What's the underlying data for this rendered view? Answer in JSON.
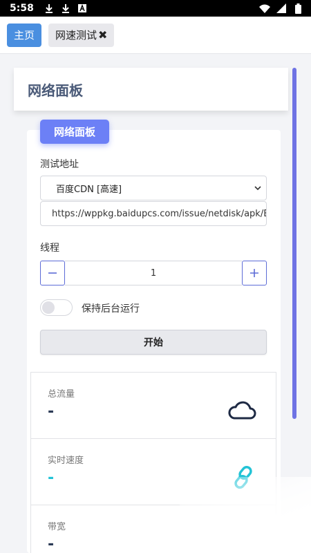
{
  "status_bar": {
    "time": "5:58",
    "left_icons": [
      "download-icon",
      "download-icon",
      "a-box-icon"
    ],
    "right_icons": [
      "wifi-icon",
      "signal-icon",
      "battery-icon"
    ]
  },
  "tabs": [
    {
      "label": "主页",
      "active": true
    },
    {
      "label": "网速测试",
      "close": "✖",
      "active": false
    }
  ],
  "panel": {
    "title": "网络面板",
    "badge": "网络面板"
  },
  "form": {
    "address_label": "测试地址",
    "server_select": "百度CDN [高速]",
    "url_value": "https://wppkg.baidupcs.com/issue/netdisk/apk/BaiduNetdisk",
    "threads_label": "线程",
    "threads_value": "1",
    "background_label": "保持后台运行",
    "background_enabled": false,
    "start_button": "开始"
  },
  "stats": [
    {
      "label": "总流量",
      "value": "-",
      "icon": "cloud-icon"
    },
    {
      "label": "实时速度",
      "value": "-",
      "icon": "link-icon"
    },
    {
      "label": "带宽",
      "value": "-",
      "icon": ""
    }
  ],
  "colors": {
    "primary": "#6c80f6",
    "home_tab": "#4a8fe0",
    "accent": "#22c3d6",
    "scrollbar": "#6f73e4",
    "header_text": "#4a5a78"
  }
}
